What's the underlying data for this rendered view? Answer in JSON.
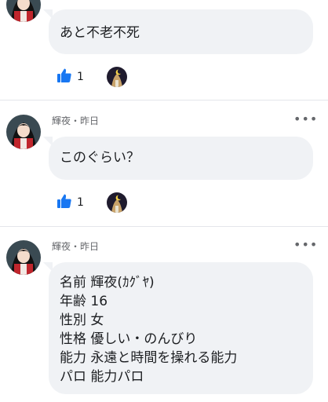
{
  "comments": [
    {
      "body": "あと不老不死",
      "likes": "1"
    },
    {
      "meta": "輝夜・昨日",
      "more_icon": "ellipsis-icon",
      "body": "このぐらい？",
      "likes": "1"
    },
    {
      "meta": "輝夜・昨日",
      "more_icon": "ellipsis-icon",
      "body": "名前 輝夜(ｶｸﾞﾔ)\n年齢 16\n性別 女\n性格 優しい・のんびり\n能力 永遠と時間を操れる能力\nパロ 能力パロ"
    }
  ],
  "colors": {
    "bubble": "#f0f2f5",
    "like_blue": "#1877f2",
    "meta": "#65676b"
  }
}
